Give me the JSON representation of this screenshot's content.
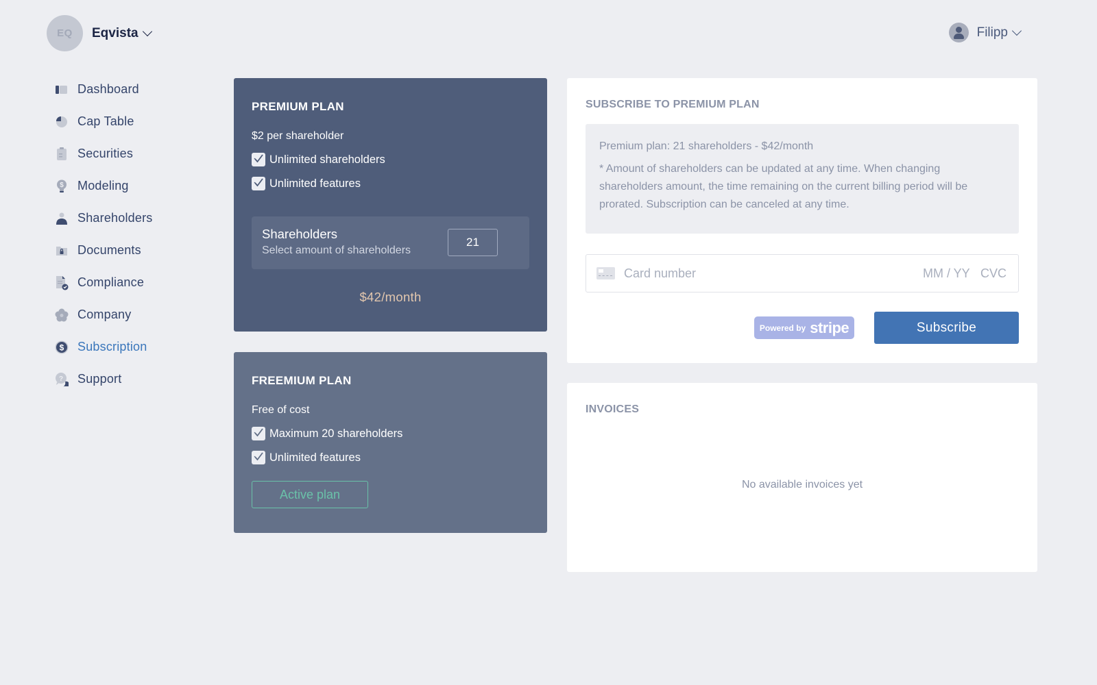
{
  "header": {
    "org_initials": "EQ",
    "org_name": "Eqvista",
    "user_name": "Filipp"
  },
  "sidebar": {
    "items": [
      {
        "label": "Dashboard",
        "icon": "dashboard-icon"
      },
      {
        "label": "Cap Table",
        "icon": "pie-chart-icon"
      },
      {
        "label": "Securities",
        "icon": "clipboard-icon"
      },
      {
        "label": "Modeling",
        "icon": "lightbulb-dollar-icon"
      },
      {
        "label": "Shareholders",
        "icon": "person-icon"
      },
      {
        "label": "Documents",
        "icon": "locked-folder-icon"
      },
      {
        "label": "Compliance",
        "icon": "document-check-icon"
      },
      {
        "label": "Company",
        "icon": "flower-icon"
      },
      {
        "label": "Subscription",
        "icon": "dollar-coin-icon",
        "active": true
      },
      {
        "label": "Support",
        "icon": "help-chat-icon"
      }
    ]
  },
  "premium": {
    "title": "PREMIUM PLAN",
    "price": "$2 per shareholder",
    "features": [
      "Unlimited shareholders",
      "Unlimited features"
    ],
    "shareholders_title": "Shareholders",
    "shareholders_sub": "Select amount of shareholders",
    "shareholders_value": "21",
    "monthly": "$42/month"
  },
  "freemium": {
    "title": "FREEMIUM PLAN",
    "price": "Free of cost",
    "features": [
      "Maximum 20 shareholders",
      "Unlimited features"
    ],
    "active_label": "Active plan"
  },
  "subscribe": {
    "title": "SUBSCRIBE TO PREMIUM PLAN",
    "summary": "Premium plan: 21 shareholders - $42/month",
    "note": "* Amount of shareholders can be updated at any time. When changing shareholders amount, the time remaining on the current billing period will be prorated. Subscription can be canceled at any time.",
    "card_placeholder": "Card number",
    "expiry_placeholder": "MM / YY",
    "cvc_placeholder": "CVC",
    "powered_by": "Powered by",
    "stripe_word": "stripe",
    "button": "Subscribe"
  },
  "invoices": {
    "title": "INVOICES",
    "empty": "No available invoices yet"
  },
  "colors": {
    "accent": "#4274b4",
    "active_nav": "#3a76bb",
    "premium_bg": "#4f5d7a",
    "freemium_bg": "#647189",
    "active_plan": "#6ac2a9",
    "price_highlight": "#e3c7ae"
  }
}
